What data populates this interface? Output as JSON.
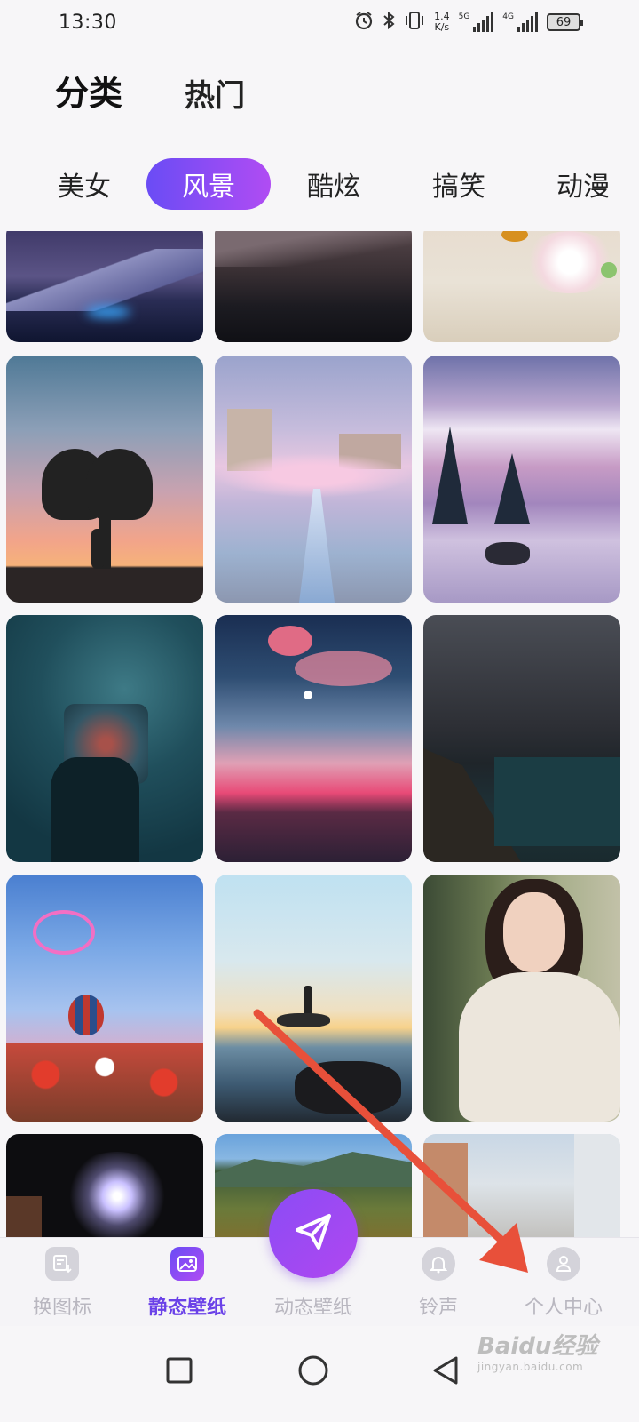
{
  "status_bar": {
    "time": "13:30",
    "net_speed_value": "1.4",
    "net_speed_unit": "K/s",
    "sim1_tag": "5G",
    "sim2_tag": "4G",
    "battery": "69",
    "icons": [
      "alarm-icon",
      "bluetooth-icon",
      "vibrate-icon",
      "signal-icon",
      "signal-icon",
      "battery-icon"
    ]
  },
  "top_tabs": [
    {
      "label": "分类",
      "active": true
    },
    {
      "label": "热门",
      "active": false
    }
  ],
  "categories": [
    {
      "label": "美女",
      "active": false
    },
    {
      "label": "风景",
      "active": true
    },
    {
      "label": "酷炫",
      "active": false
    },
    {
      "label": "搞笑",
      "active": false
    },
    {
      "label": "动漫",
      "active": false
    }
  ],
  "wallpapers": [
    {
      "name": "snowy-mountain-night"
    },
    {
      "name": "dark-valley"
    },
    {
      "name": "cherry-blossom-butterfly"
    },
    {
      "name": "heart-tree-sunset"
    },
    {
      "name": "city-canal-blossoms"
    },
    {
      "name": "snow-peak-lake-deer"
    },
    {
      "name": "star-jar-hand"
    },
    {
      "name": "pink-sky-couple"
    },
    {
      "name": "night-coast-milkyway"
    },
    {
      "name": "balloon-tulips"
    },
    {
      "name": "sunset-rock-figure"
    },
    {
      "name": "girl-white-dress"
    },
    {
      "name": "fireworks"
    },
    {
      "name": "mountain-forest"
    },
    {
      "name": "city-street"
    }
  ],
  "bottom_nav": [
    {
      "label": "换图标",
      "icon": "change-icon-icon",
      "active": false
    },
    {
      "label": "静态壁纸",
      "icon": "image-icon",
      "active": true
    },
    {
      "label": "动态壁纸",
      "icon": "send-icon",
      "active": false
    },
    {
      "label": "铃声",
      "icon": "bell-icon",
      "active": false
    },
    {
      "label": "个人中心",
      "icon": "person-icon",
      "active": false
    }
  ],
  "system_nav": [
    "recent-apps-icon",
    "home-icon",
    "back-icon"
  ],
  "watermark": {
    "main": "Baidu经验",
    "sub": "jingyan.baidu.com"
  },
  "colors": {
    "accent": "#7a4cf3",
    "accent_end": "#b04cf3",
    "arrow": "#e8503a"
  }
}
